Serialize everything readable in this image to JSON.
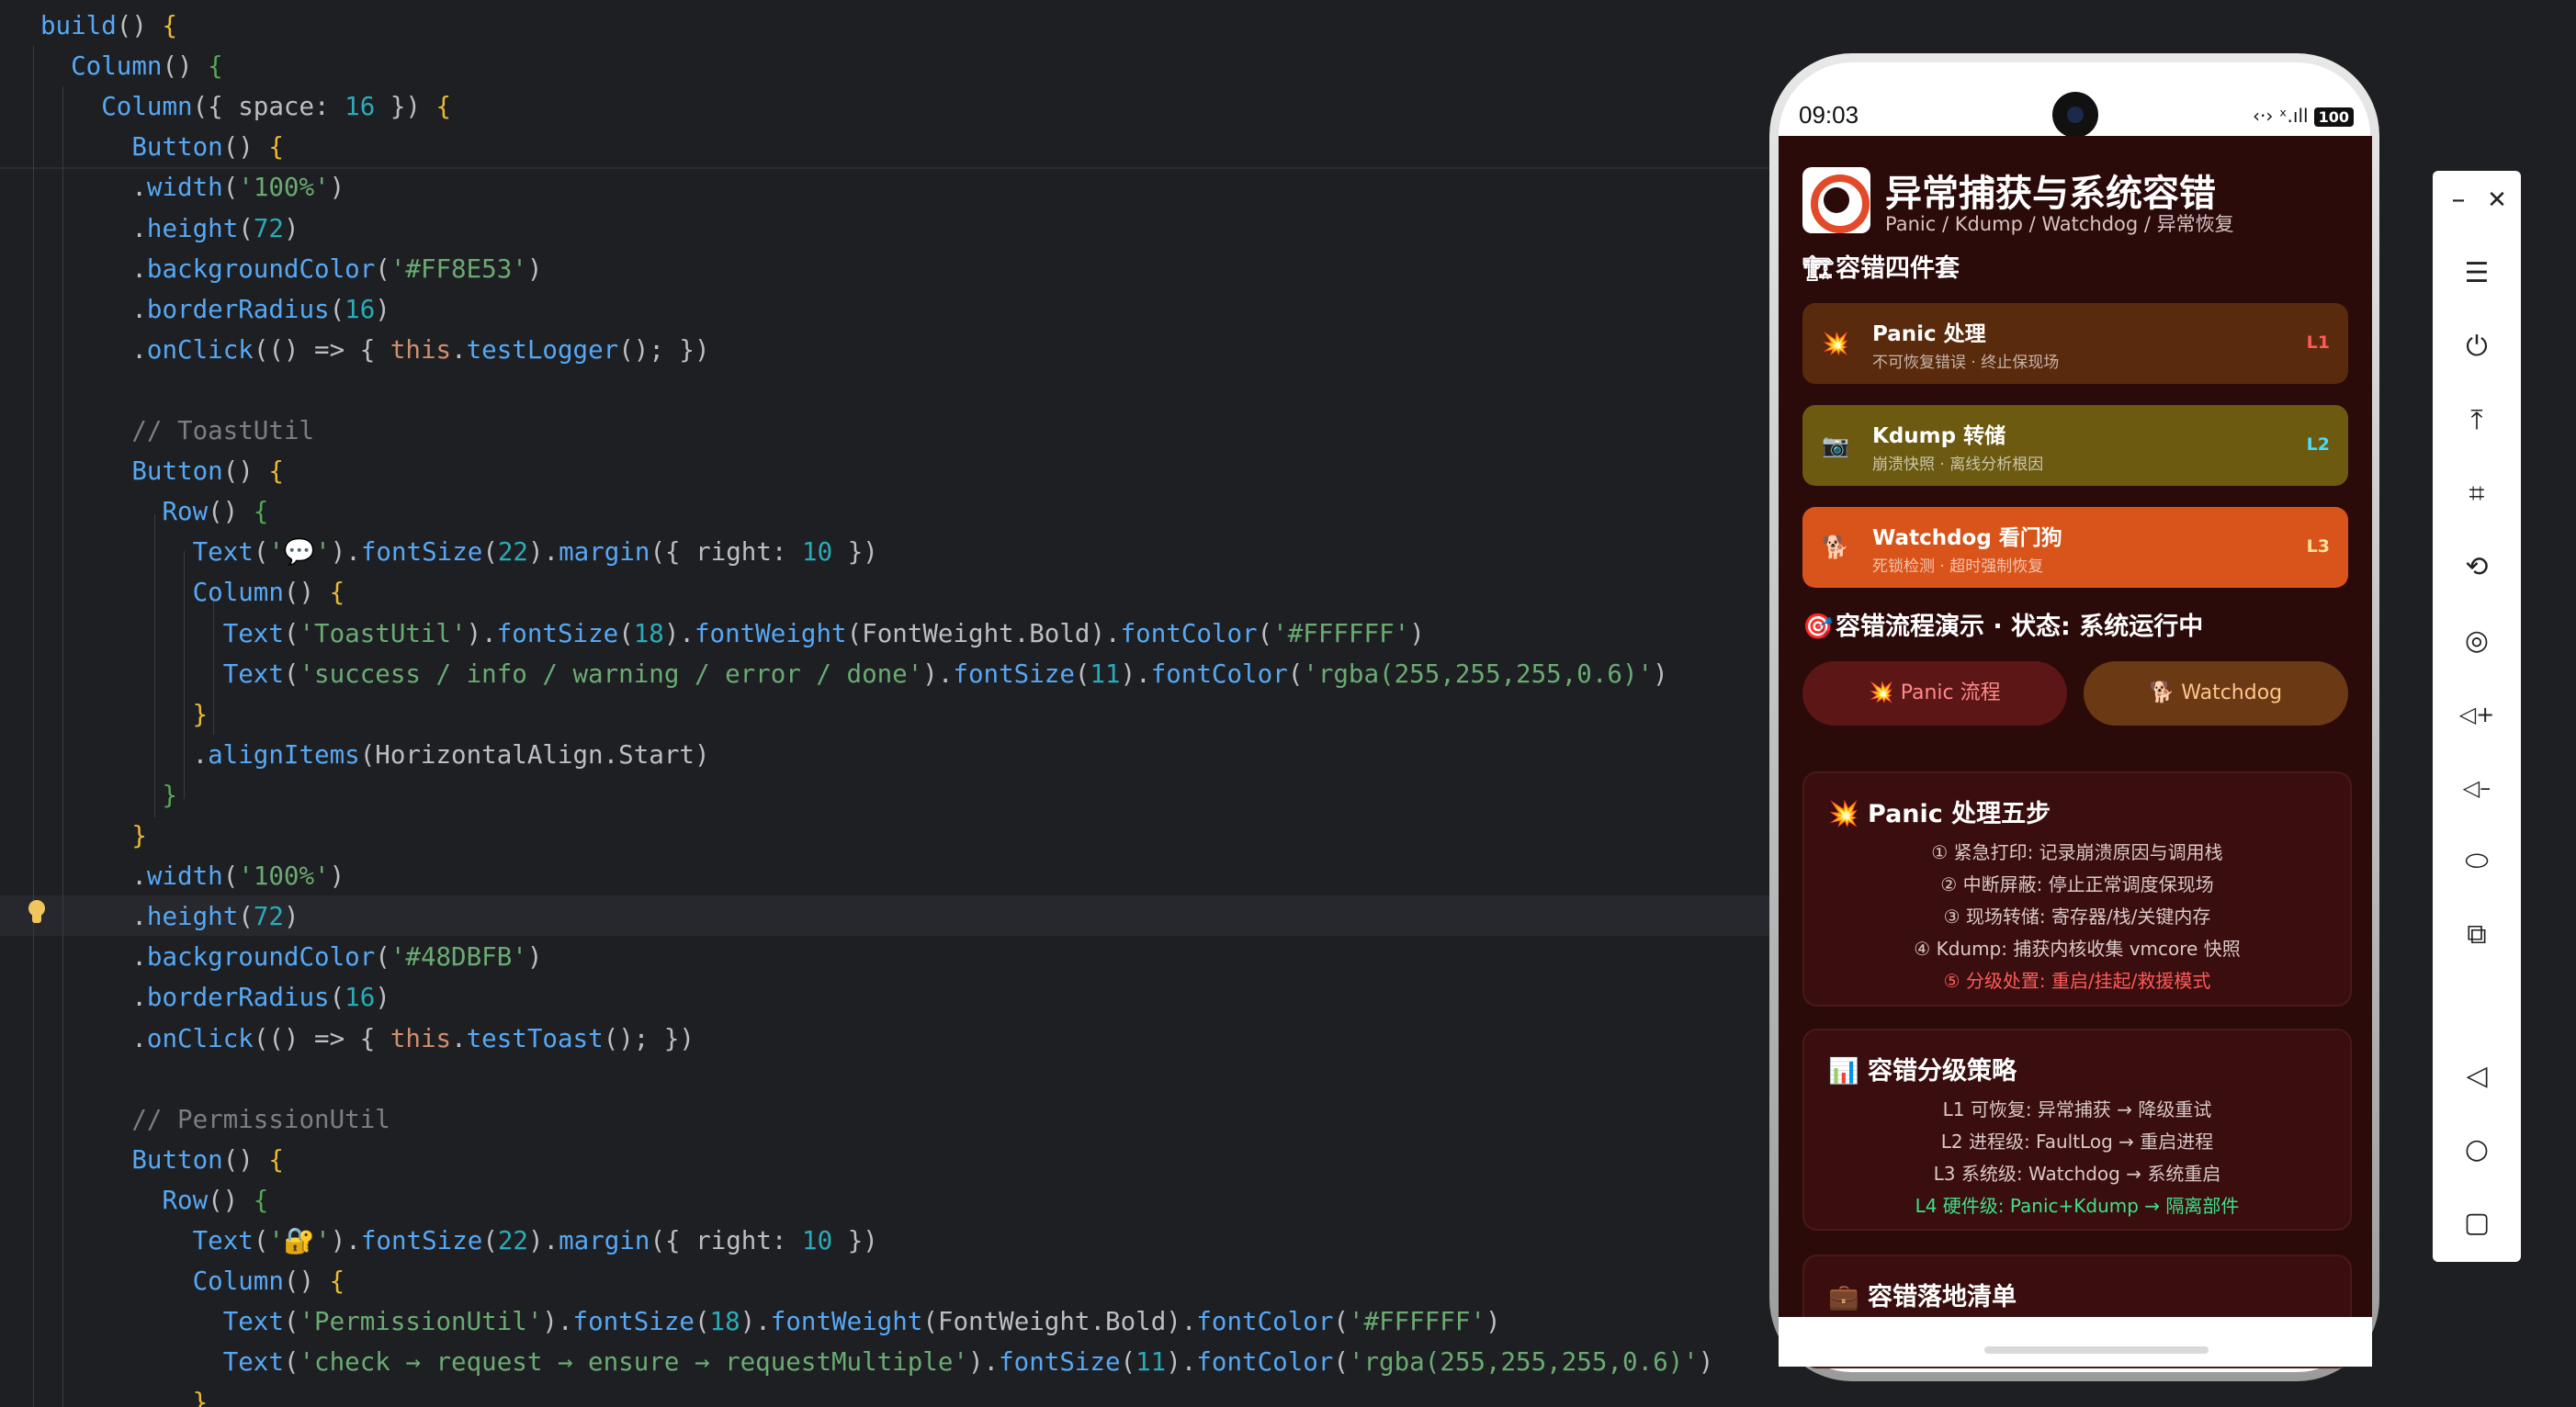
{
  "editor": {
    "lines": [
      [
        [
          "fn",
          "build"
        ],
        [
          "id",
          "() "
        ],
        [
          "br",
          "{"
        ]
      ],
      [
        [
          "id",
          "  "
        ],
        [
          "fn",
          "Column"
        ],
        [
          "id",
          "() "
        ],
        [
          "br2",
          "{"
        ]
      ],
      [
        [
          "id",
          "    "
        ],
        [
          "fn",
          "Column"
        ],
        [
          "id",
          "({ space: "
        ],
        [
          "num",
          "16"
        ],
        [
          "id",
          " }) "
        ],
        [
          "br",
          "{"
        ]
      ],
      [
        [
          "id",
          "      "
        ],
        [
          "fn",
          "Button"
        ],
        [
          "id",
          "() "
        ],
        [
          "br",
          "{"
        ]
      ],
      [
        [
          "id",
          "      ."
        ],
        [
          "fn",
          "width"
        ],
        [
          "id",
          "("
        ],
        [
          "str",
          "'100%'"
        ],
        [
          "id",
          ")"
        ]
      ],
      [
        [
          "id",
          "      ."
        ],
        [
          "fn",
          "height"
        ],
        [
          "id",
          "("
        ],
        [
          "num",
          "72"
        ],
        [
          "id",
          ")"
        ]
      ],
      [
        [
          "id",
          "      ."
        ],
        [
          "fn",
          "backgroundColor"
        ],
        [
          "id",
          "("
        ],
        [
          "str",
          "'#FF8E53'"
        ],
        [
          "id",
          ")"
        ]
      ],
      [
        [
          "id",
          "      ."
        ],
        [
          "fn",
          "borderRadius"
        ],
        [
          "id",
          "("
        ],
        [
          "num",
          "16"
        ],
        [
          "id",
          ")"
        ]
      ],
      [
        [
          "id",
          "      ."
        ],
        [
          "fn",
          "onClick"
        ],
        [
          "id",
          "(() => { "
        ],
        [
          "this",
          "this"
        ],
        [
          "id",
          "."
        ],
        [
          "fn",
          "testLogger"
        ],
        [
          "id",
          "(); })"
        ]
      ],
      [
        [
          "id",
          ""
        ]
      ],
      [
        [
          "id",
          "      "
        ],
        [
          "cm",
          "// ToastUtil"
        ]
      ],
      [
        [
          "id",
          "      "
        ],
        [
          "fn",
          "Button"
        ],
        [
          "id",
          "() "
        ],
        [
          "br",
          "{"
        ]
      ],
      [
        [
          "id",
          "        "
        ],
        [
          "fn",
          "Row"
        ],
        [
          "id",
          "() "
        ],
        [
          "br2",
          "{"
        ]
      ],
      [
        [
          "id",
          "          "
        ],
        [
          "fn",
          "Text"
        ],
        [
          "id",
          "("
        ],
        [
          "str",
          "'💬'"
        ],
        [
          "id",
          ")."
        ],
        [
          "fn",
          "fontSize"
        ],
        [
          "id",
          "("
        ],
        [
          "num",
          "22"
        ],
        [
          "id",
          ")."
        ],
        [
          "fn",
          "margin"
        ],
        [
          "id",
          "({ right: "
        ],
        [
          "num",
          "10"
        ],
        [
          "id",
          " })"
        ]
      ],
      [
        [
          "id",
          "          "
        ],
        [
          "fn",
          "Column"
        ],
        [
          "id",
          "() "
        ],
        [
          "br",
          "{"
        ]
      ],
      [
        [
          "id",
          "            "
        ],
        [
          "fn",
          "Text"
        ],
        [
          "id",
          "("
        ],
        [
          "str",
          "'ToastUtil'"
        ],
        [
          "id",
          ")."
        ],
        [
          "fn",
          "fontSize"
        ],
        [
          "id",
          "("
        ],
        [
          "num",
          "18"
        ],
        [
          "id",
          ")."
        ],
        [
          "fn",
          "fontWeight"
        ],
        [
          "id",
          "(FontWeight.Bold)."
        ],
        [
          "fn",
          "fontColor"
        ],
        [
          "id",
          "("
        ],
        [
          "str",
          "'#FFFFFF'"
        ],
        [
          "id",
          ")"
        ]
      ],
      [
        [
          "id",
          "            "
        ],
        [
          "fn",
          "Text"
        ],
        [
          "id",
          "("
        ],
        [
          "str",
          "'success / info / warning / error / done'"
        ],
        [
          "id",
          ")."
        ],
        [
          "fn",
          "fontSize"
        ],
        [
          "id",
          "("
        ],
        [
          "num",
          "11"
        ],
        [
          "id",
          ")."
        ],
        [
          "fn",
          "fontColor"
        ],
        [
          "id",
          "("
        ],
        [
          "str",
          "'rgba(255,255,255,0.6)'"
        ],
        [
          "id",
          ")"
        ]
      ],
      [
        [
          "id",
          "          "
        ],
        [
          "br",
          "}"
        ]
      ],
      [
        [
          "id",
          "          ."
        ],
        [
          "fn",
          "alignItems"
        ],
        [
          "id",
          "(HorizontalAlign.Start)"
        ]
      ],
      [
        [
          "id",
          "        "
        ],
        [
          "br2",
          "}"
        ]
      ],
      [
        [
          "id",
          "      "
        ],
        [
          "br",
          "}"
        ]
      ],
      [
        [
          "id",
          "      ."
        ],
        [
          "fn",
          "width"
        ],
        [
          "id",
          "("
        ],
        [
          "str",
          "'100%'"
        ],
        [
          "id",
          ")"
        ]
      ],
      [
        [
          "id",
          "      ."
        ],
        [
          "fn",
          "height"
        ],
        [
          "id",
          "("
        ],
        [
          "num",
          "72"
        ],
        [
          "id",
          ")"
        ]
      ],
      [
        [
          "id",
          "      ."
        ],
        [
          "fn",
          "backgroundColor"
        ],
        [
          "id",
          "("
        ],
        [
          "str",
          "'#48DBFB'"
        ],
        [
          "id",
          ")"
        ]
      ],
      [
        [
          "id",
          "      ."
        ],
        [
          "fn",
          "borderRadius"
        ],
        [
          "id",
          "("
        ],
        [
          "num",
          "16"
        ],
        [
          "id",
          ")"
        ]
      ],
      [
        [
          "id",
          "      ."
        ],
        [
          "fn",
          "onClick"
        ],
        [
          "id",
          "(() => { "
        ],
        [
          "this",
          "this"
        ],
        [
          "id",
          "."
        ],
        [
          "fn",
          "testToast"
        ],
        [
          "id",
          "(); })"
        ]
      ],
      [
        [
          "id",
          ""
        ]
      ],
      [
        [
          "id",
          "      "
        ],
        [
          "cm",
          "// PermissionUtil"
        ]
      ],
      [
        [
          "id",
          "      "
        ],
        [
          "fn",
          "Button"
        ],
        [
          "id",
          "() "
        ],
        [
          "br",
          "{"
        ]
      ],
      [
        [
          "id",
          "        "
        ],
        [
          "fn",
          "Row"
        ],
        [
          "id",
          "() "
        ],
        [
          "br2",
          "{"
        ]
      ],
      [
        [
          "id",
          "          "
        ],
        [
          "fn",
          "Text"
        ],
        [
          "id",
          "("
        ],
        [
          "str",
          "'🔐'"
        ],
        [
          "id",
          ")."
        ],
        [
          "fn",
          "fontSize"
        ],
        [
          "id",
          "("
        ],
        [
          "num",
          "22"
        ],
        [
          "id",
          ")."
        ],
        [
          "fn",
          "margin"
        ],
        [
          "id",
          "({ right: "
        ],
        [
          "num",
          "10"
        ],
        [
          "id",
          " })"
        ]
      ],
      [
        [
          "id",
          "          "
        ],
        [
          "fn",
          "Column"
        ],
        [
          "id",
          "() "
        ],
        [
          "br",
          "{"
        ]
      ],
      [
        [
          "id",
          "            "
        ],
        [
          "fn",
          "Text"
        ],
        [
          "id",
          "("
        ],
        [
          "str",
          "'PermissionUtil'"
        ],
        [
          "id",
          ")."
        ],
        [
          "fn",
          "fontSize"
        ],
        [
          "id",
          "("
        ],
        [
          "num",
          "18"
        ],
        [
          "id",
          ")."
        ],
        [
          "fn",
          "fontWeight"
        ],
        [
          "id",
          "(FontWeight.Bold)."
        ],
        [
          "fn",
          "fontColor"
        ],
        [
          "id",
          "("
        ],
        [
          "str",
          "'#FFFFFF'"
        ],
        [
          "id",
          ")"
        ]
      ],
      [
        [
          "id",
          "            "
        ],
        [
          "fn",
          "Text"
        ],
        [
          "id",
          "("
        ],
        [
          "str",
          "'check → request → ensure → requestMultiple'"
        ],
        [
          "id",
          ")."
        ],
        [
          "fn",
          "fontSize"
        ],
        [
          "id",
          "("
        ],
        [
          "num",
          "11"
        ],
        [
          "id",
          ")."
        ],
        [
          "fn",
          "fontColor"
        ],
        [
          "id",
          "("
        ],
        [
          "str",
          "'rgba(255,255,255,0.6)'"
        ],
        [
          "id",
          ")"
        ]
      ],
      [
        [
          "id",
          "          "
        ],
        [
          "br",
          "}"
        ]
      ]
    ]
  },
  "phone": {
    "status": {
      "time": "09:03",
      "icons": "‹·› ˣ.ıll",
      "battery": "100"
    },
    "app": {
      "title": "异常捕获与系统容错",
      "subtitle": "Panic / Kdump / Watchdog / 异常恢复",
      "section_kit": {
        "icon": "🏗",
        "label": "容错四件套"
      },
      "cards": [
        {
          "icon": "💥",
          "title": "Panic 处理",
          "sub": "不可恢复错误 · 终止保现场",
          "level": "L1",
          "bg": "#5a2a0c",
          "level_color": "#ff5a5a"
        },
        {
          "icon": "📷",
          "title": "Kdump 转储",
          "sub": "崩溃快照 · 离线分析根因",
          "level": "L2",
          "bg": "#6b5a10",
          "level_color": "#48dbfb"
        },
        {
          "icon": "🐕",
          "title": "Watchdog 看门狗",
          "sub": "死锁检测 · 超时强制恢复",
          "level": "L3",
          "bg": "#d9541a",
          "level_color": "#ffe3a0"
        }
      ],
      "section_flow": {
        "icon": "🎯",
        "label": "容错流程演示 · 状态: 系统运行中"
      },
      "buttons": [
        {
          "label": "💥 Panic 流程",
          "bg": "#5c1616",
          "color": "#ff8a8a"
        },
        {
          "label": "🐕 Watchdog",
          "bg": "#6b3a14",
          "color": "#ffc48a"
        }
      ],
      "panic_panel": {
        "title": "💥 Panic 处理五步",
        "lines": [
          {
            "text": "① 紧急打印: 记录崩溃原因与调用栈",
            "color": "#d9c8c8"
          },
          {
            "text": "② 中断屏蔽: 停止正常调度保现场",
            "color": "#d9c8c8"
          },
          {
            "text": "③ 现场转储: 寄存器/栈/关键内存",
            "color": "#d9c8c8"
          },
          {
            "text": "④ Kdump: 捕获内核收集 vmcore 快照",
            "color": "#d9c8c8"
          },
          {
            "text": "⑤ 分级处置: 重启/挂起/救援模式",
            "color": "#ff5a5a"
          }
        ]
      },
      "strategy_panel": {
        "title": "📊 容错分级策略",
        "lines": [
          {
            "text": "L1 可恢复: 异常捕获 → 降级重试",
            "color": "#d9c8c8"
          },
          {
            "text": "L2 进程级: FaultLog → 重启进程",
            "color": "#d9c8c8"
          },
          {
            "text": "L3 系统级: Watchdog → 系统重启",
            "color": "#d9c8c8"
          },
          {
            "text": "L4 硬件级: Panic+Kdump → 隔离部件",
            "color": "#3fe08a"
          }
        ]
      },
      "checklist_panel": {
        "title": "💼 容错落地清单"
      }
    }
  },
  "toolbar": {
    "items": [
      "minimize-icon",
      "close-icon",
      "menu-icon",
      "power-icon",
      "pin-top-icon",
      "crop-icon",
      "rotate-icon",
      "screenshot-icon",
      "volume-up-icon",
      "volume-down-icon",
      "shake-icon",
      "multi-device-icon",
      "back-icon",
      "home-icon",
      "recents-icon"
    ],
    "glyphs": {
      "minimize": "–",
      "close": "✕",
      "menu": "☰",
      "power": "⏻",
      "pin": "⤒",
      "crop": "⌗",
      "rotate": "⟲",
      "screenshot": "◎",
      "volup": "◁+",
      "voldown": "◁–",
      "shake": "⬭",
      "multi": "⧉",
      "back": "◁",
      "home": "○",
      "recents": "▢"
    }
  },
  "colors": {
    "editor_bg": "#1e1f22",
    "screen_bg": "#2b0a0a",
    "panel_bg": "#3a0e0e"
  }
}
